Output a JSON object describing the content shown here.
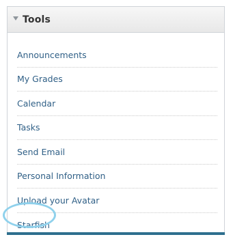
{
  "tools_panel": {
    "title": "Tools",
    "items": [
      {
        "label": "Announcements"
      },
      {
        "label": "My Grades"
      },
      {
        "label": "Calendar"
      },
      {
        "label": "Tasks"
      },
      {
        "label": "Send Email"
      },
      {
        "label": "Personal Information"
      },
      {
        "label": "Upload your Avatar"
      },
      {
        "label": "Starfish",
        "highlighted": true
      }
    ]
  },
  "colors": {
    "link": "#2f5f86",
    "highlight_ring": "#8fd1ec",
    "header_bg": "#eeeeee",
    "border": "#cfd3d8"
  }
}
